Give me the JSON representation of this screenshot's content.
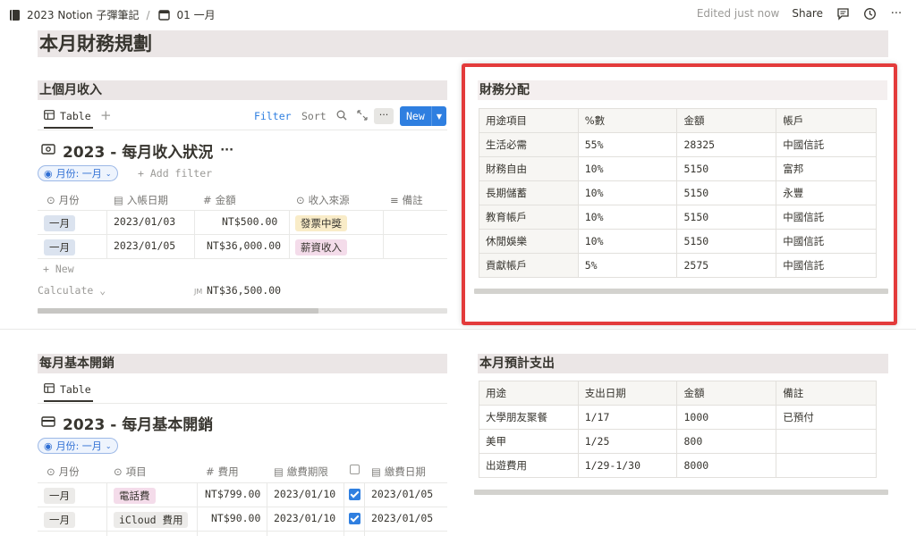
{
  "topbar": {
    "workspace": "2023 Notion 子彈筆記",
    "separator": "/",
    "page": "01 一月",
    "edited": "Edited just now",
    "share": "Share"
  },
  "page_title": "本月財務規劃",
  "income": {
    "section_title": "上個月收入",
    "view_tab": "Table",
    "toolbar": {
      "filter": "Filter",
      "sort": "Sort",
      "more": "···",
      "new": "New"
    },
    "db_title": "2023 - 每月收入狀況",
    "db_more": "···",
    "filter_pill": "月份: 一月",
    "add_filter": "+ Add filter",
    "columns": [
      "月份",
      "入帳日期",
      "金額",
      "收入來源",
      "備註"
    ],
    "rows": [
      {
        "month": "一月",
        "date": "2023/01/03",
        "amount": "NT$500.00",
        "source": "發票中獎"
      },
      {
        "month": "一月",
        "date": "2023/01/05",
        "amount": "NT$36,000.00",
        "source": "薪資收入"
      }
    ],
    "new_row": "+ New",
    "calculate": "Calculate",
    "sum_label": "JM",
    "sum_value": "NT$36,500.00"
  },
  "allocation": {
    "title": "財務分配",
    "header": [
      "用途項目",
      "%數",
      "金額",
      "帳戶"
    ],
    "rows": [
      [
        "生活必需",
        "55%",
        "28325",
        "中國信託"
      ],
      [
        "財務自由",
        "10%",
        "5150",
        "富邦"
      ],
      [
        "長期儲蓄",
        "10%",
        "5150",
        "永豐"
      ],
      [
        "教育帳戶",
        "10%",
        "5150",
        "中國信託"
      ],
      [
        "休閒娛樂",
        "10%",
        "5150",
        "中國信託"
      ],
      [
        "貢獻帳戶",
        "5%",
        "2575",
        "中國信託"
      ]
    ]
  },
  "expenses": {
    "section_title": "每月基本開銷",
    "view_tab": "Table",
    "db_title": "2023 - 每月基本開銷",
    "filter_pill": "月份: 一月",
    "columns": [
      "月份",
      "項目",
      "費用",
      "繳費期限",
      "",
      "繳費日期"
    ],
    "rows": [
      {
        "month": "一月",
        "item": "電話費",
        "fee": "NT$799.00",
        "due": "2023/01/10",
        "paid": "2023/01/05"
      },
      {
        "month": "一月",
        "item": "iCloud 費用",
        "fee": "NT$90.00",
        "due": "2023/01/10",
        "paid": "2023/01/05"
      }
    ]
  },
  "planned": {
    "title": "本月預計支出",
    "header": [
      "用途",
      "支出日期",
      "金額",
      "備註"
    ],
    "rows": [
      [
        "大學朋友聚餐",
        "1/17",
        "1000",
        "已預付"
      ],
      [
        "美甲",
        "1/25",
        "800",
        ""
      ],
      [
        "出遊費用",
        "1/29-1/30",
        "8000",
        ""
      ]
    ]
  },
  "colors": {
    "accent": "#2f7fe0",
    "highlight_frame": "#e33b3b",
    "tag_month": "#dbe3ef",
    "tag_income_lottery": "#f9ecc8",
    "tag_income_salary": "#f4dcea",
    "tag_item_phone": "#f4dcea",
    "tag_item_icloud": "#ecebe9"
  }
}
